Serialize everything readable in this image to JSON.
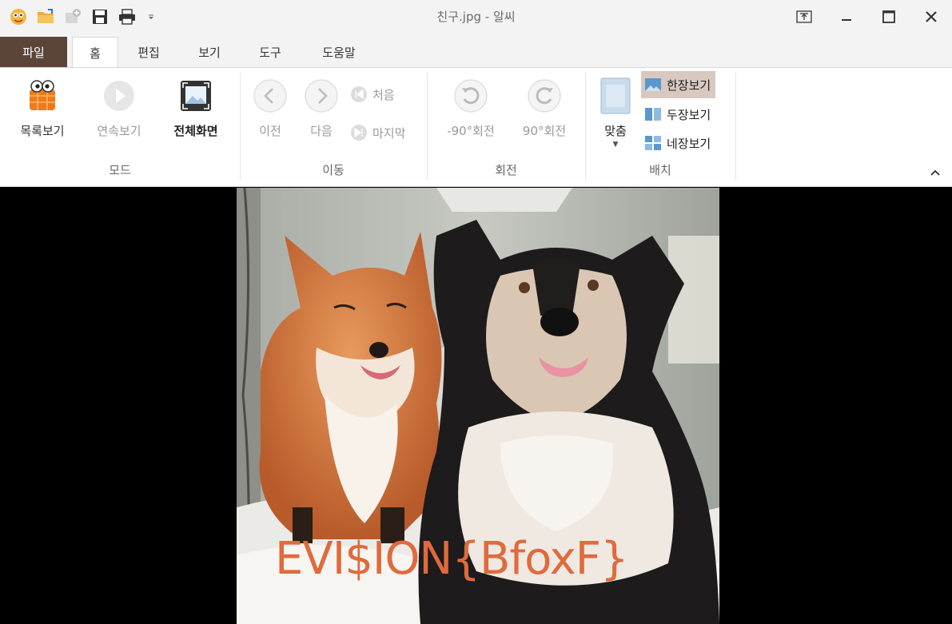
{
  "window": {
    "title": "친구.jpg - 알씨",
    "controls": {
      "pin": "pin",
      "minimize": "minimize",
      "maximize": "maximize",
      "close": "close"
    }
  },
  "quick_access": [
    "app-logo-icon",
    "open-folder-icon",
    "new-icon",
    "save-icon",
    "print-icon",
    "customize-dropdown-icon"
  ],
  "tabs": [
    {
      "label": "파일",
      "active": false
    },
    {
      "label": "홈",
      "active": true
    },
    {
      "label": "편집",
      "active": false
    },
    {
      "label": "보기",
      "active": false
    },
    {
      "label": "도구",
      "active": false
    },
    {
      "label": "도움말",
      "active": false
    }
  ],
  "ribbon": {
    "mode": {
      "label": "모드",
      "list_view": "목록보기",
      "slideshow": "연속보기",
      "fullscreen": "전체화면"
    },
    "move": {
      "label": "이동",
      "prev": "이전",
      "next": "다음",
      "first": "처음",
      "last": "마지막"
    },
    "rotate": {
      "label": "회전",
      "ccw": "-90°회전",
      "cw": "90°회전"
    },
    "layout": {
      "label": "배치",
      "fit": "맞춤",
      "single": "한장보기",
      "double": "두장보기",
      "quad": "네장보기",
      "selected": "한장보기"
    }
  },
  "image": {
    "watermark": "EVI$ION{BfoxF}"
  },
  "colors": {
    "file_tab": "#5b4539",
    "selected_layout": "#d8c8c0",
    "watermark": "#e06a3c"
  }
}
